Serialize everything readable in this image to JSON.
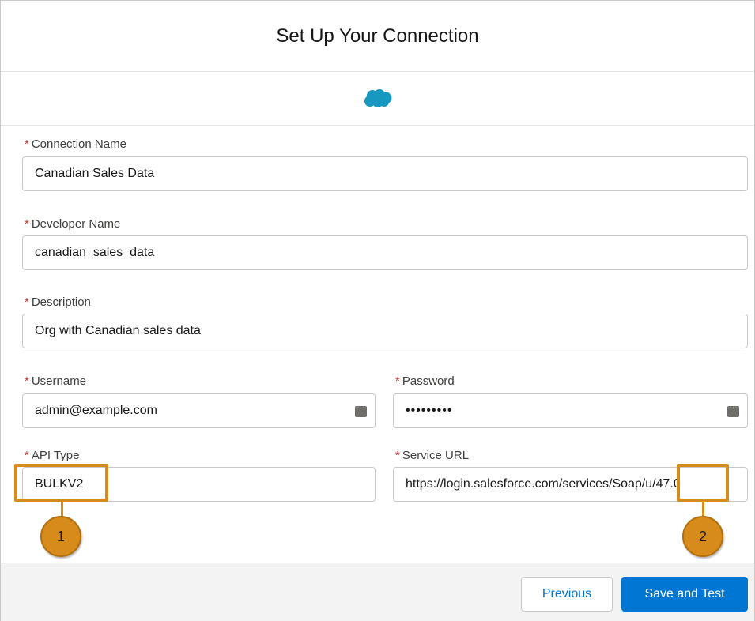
{
  "modal": {
    "title": "Set Up Your Connection",
    "brand_icon": "salesforce-cloud-icon",
    "brand_color": "#1798c1"
  },
  "fields": {
    "connection_name": {
      "label": "Connection Name",
      "value": "Canadian Sales Data"
    },
    "developer_name": {
      "label": "Developer Name",
      "value": "canadian_sales_data"
    },
    "description": {
      "label": "Description",
      "value": "Org with Canadian sales data"
    },
    "username": {
      "label": "Username",
      "value": "admin@example.com",
      "icon": "autofill-icon"
    },
    "password": {
      "label": "Password",
      "value": "•••••••••",
      "icon": "autofill-icon"
    },
    "api_type": {
      "label": "API Type",
      "value": "BULKV2"
    },
    "service_url": {
      "label": "Service URL",
      "value": "https://login.salesforce.com/services/Soap/u/47.0"
    }
  },
  "required_marker": "*",
  "callouts": [
    {
      "number": "1"
    },
    {
      "number": "2"
    }
  ],
  "callout_color": "#d68b1b",
  "footer": {
    "previous_label": "Previous",
    "save_label": "Save and Test"
  },
  "colors": {
    "accent": "#0176d3",
    "required": "#c23934"
  }
}
